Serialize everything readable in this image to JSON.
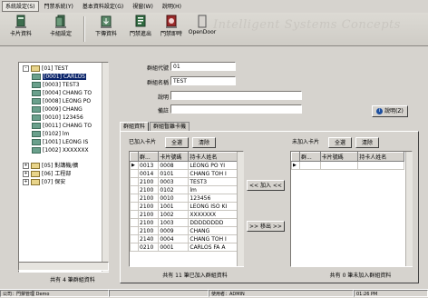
{
  "menubar": {
    "items": [
      "系統設定(S)",
      "門禁系統(Y)",
      "基本資料設定(G)",
      "視窗(W)",
      "說明(H)"
    ]
  },
  "toolbar": {
    "buttons": [
      {
        "label": "卡片資料",
        "icon": "card-data-icon"
      },
      {
        "label": "卡組設定",
        "icon": "card-group-icon"
      },
      {
        "label": "下傳資料",
        "icon": "download-data-icon"
      },
      {
        "label": "門禁進出",
        "icon": "access-log-icon"
      },
      {
        "label": "門禁即時",
        "icon": "access-realtime-icon"
      },
      {
        "label": "OpenDoor",
        "icon": "open-door-icon"
      }
    ],
    "brand_text": "Intelligent Systems Concepts"
  },
  "tree": {
    "items": [
      {
        "toggle": "-",
        "text": "[01] TEST",
        "indent": 0,
        "node": false
      },
      {
        "toggle": "",
        "text": "[0001] CARLOS",
        "indent": 1,
        "node": true,
        "selected": true
      },
      {
        "toggle": "",
        "text": "[0003] TEST3",
        "indent": 1,
        "node": true
      },
      {
        "toggle": "",
        "text": "[0004] CHANG TO",
        "indent": 1,
        "node": true
      },
      {
        "toggle": "",
        "text": "[0008] LEONG PO",
        "indent": 1,
        "node": true
      },
      {
        "toggle": "",
        "text": "[0009] CHANG",
        "indent": 1,
        "node": true
      },
      {
        "toggle": "",
        "text": "[0010] 123456",
        "indent": 1,
        "node": true
      },
      {
        "toggle": "",
        "text": "[0011] CHANG TO",
        "indent": 1,
        "node": true
      },
      {
        "toggle": "",
        "text": "[0102] lm",
        "indent": 1,
        "node": true
      },
      {
        "toggle": "",
        "text": "[1001] LEONG IS",
        "indent": 1,
        "node": true
      },
      {
        "toggle": "",
        "text": "[1002] XXXXXXX",
        "indent": 1,
        "node": true
      },
      {
        "toggle": "+",
        "text": "[05] 對講機/擴",
        "indent": 0,
        "node": false
      },
      {
        "toggle": "+",
        "text": "[06] 工程部",
        "indent": 0,
        "node": false
      },
      {
        "toggle": "+",
        "text": "[07] 保安",
        "indent": 0,
        "node": false
      }
    ],
    "footer": "共有 4 筆群組資料"
  },
  "form": {
    "group_code_label": "群組代號",
    "group_code_value": "01",
    "group_name_label": "群組名稱",
    "group_name_value": "TEST",
    "desc_label": "說明",
    "desc_value": "",
    "note_label": "備註",
    "note_value": "",
    "help_button": "說明(Z)"
  },
  "tabs": [
    "群組資料",
    "群組暫離卡機"
  ],
  "left_grid": {
    "caption": "已加入卡片",
    "select_all": "全選",
    "clear": "清除",
    "columns": [
      "群...",
      "卡片號碼",
      "持卡人姓名"
    ],
    "rows": [
      [
        "0013",
        "0008",
        "LEONG PO YI"
      ],
      [
        "0014",
        "0101",
        "CHANG TOH I"
      ],
      [
        "2100",
        "0003",
        "TEST3"
      ],
      [
        "2100",
        "0102",
        "lm"
      ],
      [
        "2100",
        "0010",
        "123456"
      ],
      [
        "2100",
        "1001",
        "LEONG ISO KI"
      ],
      [
        "2100",
        "1002",
        "XXXXXXX"
      ],
      [
        "2100",
        "1003",
        "DDDDDDDD"
      ],
      [
        "2100",
        "0009",
        "CHANG"
      ],
      [
        "2140",
        "0004",
        "CHANG TOH I"
      ],
      [
        "0210",
        "0001",
        "CARLOS FA A"
      ]
    ],
    "footer": "共有 11 筆已加入群組資料"
  },
  "transfer": {
    "add": "<< 加入 <<",
    "remove": ">> 移出 >>"
  },
  "right_grid": {
    "caption": "未加入卡片",
    "select_all": "全選",
    "clear": "清除",
    "columns": [
      "群...",
      "卡片號碼",
      "持卡人姓名"
    ],
    "footer": "共有 0 筆未加入群組資料"
  },
  "statusbar": {
    "cells": [
      "公司：門禁管理 Demo",
      "",
      "使用者：ADMIN",
      "01:26 PM"
    ]
  },
  "colors": {
    "selection": "#0a246a",
    "window_bg": "#d6d3ce"
  }
}
